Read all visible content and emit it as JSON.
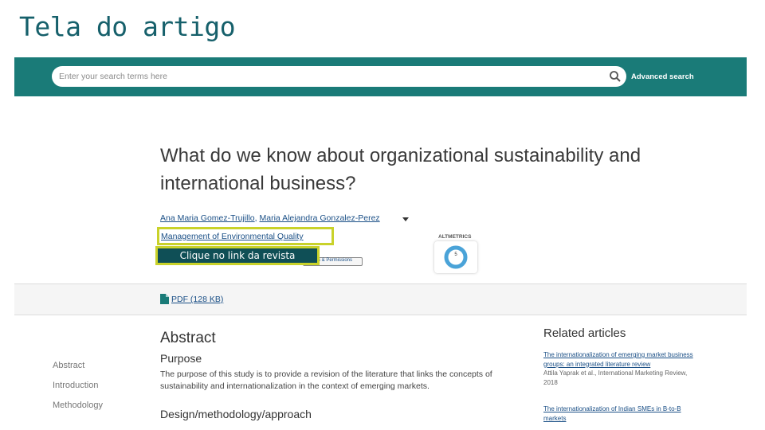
{
  "slide": {
    "title": "Tela do artigo"
  },
  "header": {
    "search_placeholder": "Enter your search terms here",
    "advanced_search": "Advanced search",
    "bar_color": "#1a7b78"
  },
  "article": {
    "title": "What do we know about organizational sustainability and international business?",
    "authors": [
      "Ana Maria Gomez-Trujillo",
      "Maria Alejandra Gonzalez-Perez"
    ],
    "author_separator": ", ",
    "journal": "Management of Environmental Quality",
    "rights_button": "Rights & Permissions"
  },
  "callout": {
    "text": "Clique no link da revista",
    "border_color": "#c9d22a"
  },
  "altmetrics": {
    "label": "ALTMETRICS",
    "score": "5"
  },
  "pdf": {
    "label": "PDF (128 KB)"
  },
  "toc": [
    "Abstract",
    "Introduction",
    "Methodology"
  ],
  "abstract": {
    "heading": "Abstract",
    "purpose_heading": "Purpose",
    "purpose_text": "The purpose of this study is to provide a revision of the literature that links the concepts of sustainability and internationalization in the context of emerging markets.",
    "design_heading": "Design/methodology/approach"
  },
  "related": {
    "heading": "Related articles",
    "items": [
      {
        "title": "The internationalization of emerging market business groups: an integrated literature review",
        "meta": "Attila Yaprak et al., International Marketing Review, 2018"
      },
      {
        "title": "The internationalization of Indian SMEs in B-to-B markets",
        "meta": ""
      }
    ]
  }
}
